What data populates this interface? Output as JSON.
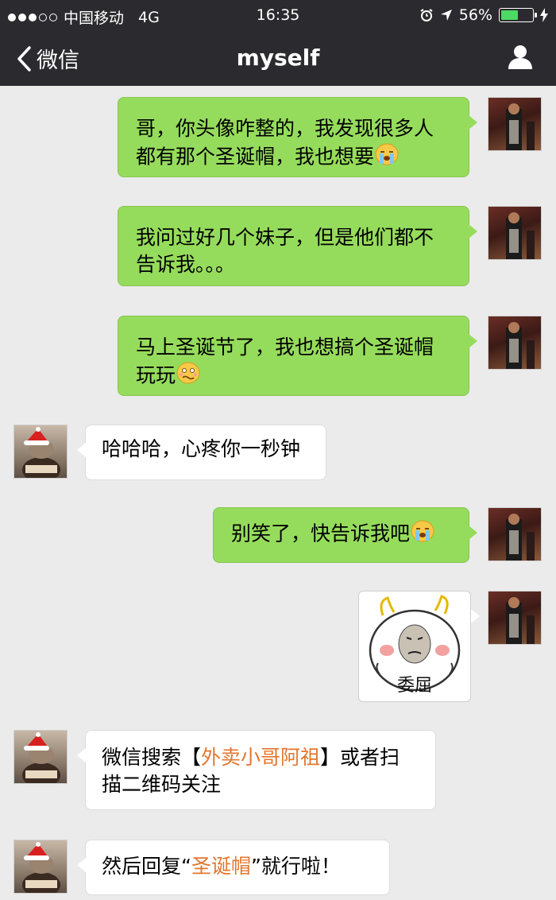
{
  "status_bar": {
    "carrier": "中国移动",
    "network": "4G",
    "time": "16:35",
    "battery_text": "56%",
    "battery_level": 0.56,
    "icons": [
      "alarm-icon",
      "location-arrow-icon",
      "charging-icon"
    ]
  },
  "nav": {
    "back_label": "微信",
    "title": "myself",
    "right_icon": "contact-icon"
  },
  "colors": {
    "bar_bg": "#2b2b2f",
    "chat_bg": "#ebebeb",
    "outgoing_bubble": "#96dc5c",
    "incoming_bubble": "#ffffff",
    "highlight": "#e4762d",
    "battery_fill": "#4cd964"
  },
  "messages": [
    {
      "direction": "out",
      "text": "哥，你头像咋整的，我发现很多人都有那个圣诞帽，我也想要",
      "emoji": "crying-emoji"
    },
    {
      "direction": "out",
      "text": "我问过好几个妹子，但是他们都不告诉我。。。"
    },
    {
      "direction": "out",
      "text": "马上圣诞节了，我也想搞个圣诞帽玩玩",
      "emoji": "awkward-emoji"
    },
    {
      "direction": "in",
      "text": "哈哈哈，心疼你一秒钟"
    },
    {
      "direction": "out",
      "text": "别笑了，快告诉我吧",
      "emoji": "crying-emoji"
    },
    {
      "direction": "out",
      "type": "sticker",
      "caption": "委屈"
    },
    {
      "direction": "in",
      "prefix": "微信搜索【",
      "highlight": "外卖小哥阿祖",
      "suffix_line1": "】或者扫",
      "line2": "描二维码关注"
    },
    {
      "direction": "in",
      "prefix": "然后回复“",
      "highlight": "圣诞帽",
      "suffix": "”就行啦！"
    }
  ]
}
